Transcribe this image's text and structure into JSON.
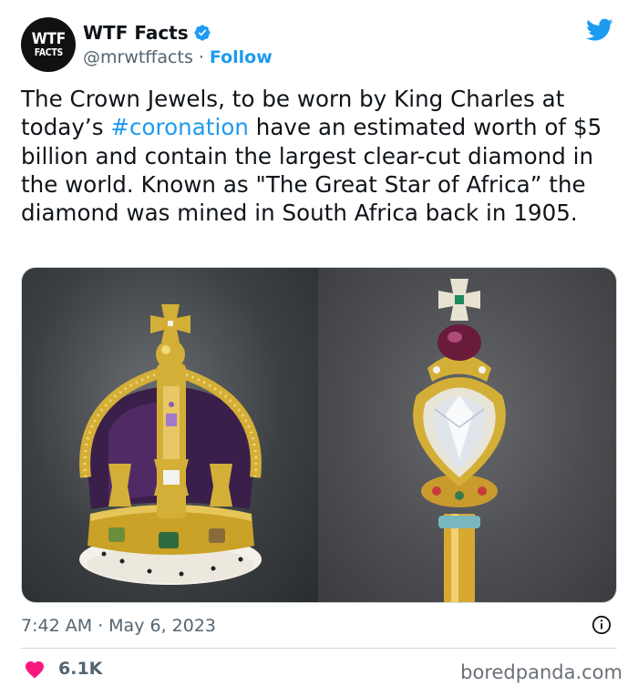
{
  "account": {
    "avatar_line1": "WTF",
    "avatar_line2": "FACTS",
    "display_name": "WTF Facts",
    "handle": "@mrwtffacts",
    "separator": "·",
    "follow_label": "Follow"
  },
  "tweet": {
    "text_before_hashtag": "The Crown Jewels, to be worn by King Charles at today’s ",
    "hashtag": "#coronation",
    "text_after_hashtag": " have an estimated worth of $5 billion and contain the largest clear-cut diamond in the world. Known as \"The Great Star of Africa” the diamond was mined in South Africa back in 1905."
  },
  "media": {
    "left_image": "crown-photo",
    "right_image": "sceptre-photo"
  },
  "meta": {
    "time": "7:42 AM",
    "separator": "·",
    "date": "May 6, 2023"
  },
  "engagement": {
    "likes": "6.1K"
  },
  "watermark": "boredpanda.com",
  "colors": {
    "accent": "#1d9bf0",
    "heart": "#f91880",
    "text_primary": "#0f1419",
    "text_secondary": "#536471"
  },
  "icons": [
    "verified-badge-icon",
    "twitter-bird-icon",
    "info-icon",
    "heart-icon"
  ]
}
